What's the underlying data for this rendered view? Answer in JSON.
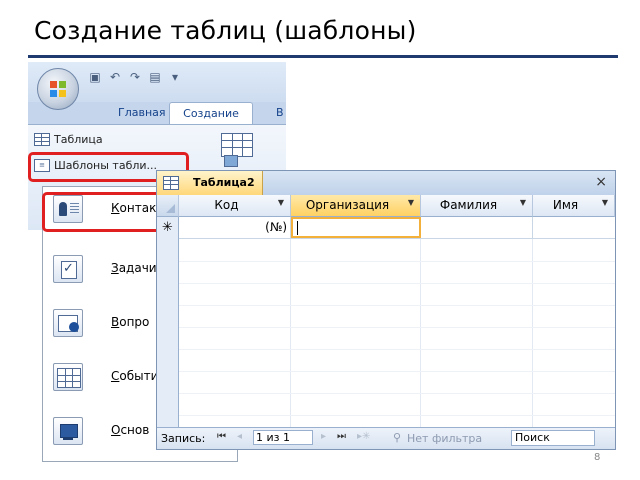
{
  "slide": {
    "title": "Создание таблиц (шаблоны)",
    "page_number": "8"
  },
  "ribbon": {
    "tabs": [
      "Главная",
      "Создание",
      "В"
    ],
    "table_label": "Таблица",
    "templates_label": "Шаблоны табли..."
  },
  "templates_menu": {
    "items": [
      {
        "accesskey": "К",
        "rest": "онтак",
        "icon": "contacts-icon"
      },
      {
        "accesskey": "З",
        "rest": "адачи",
        "icon": "tasks-icon"
      },
      {
        "accesskey": "В",
        "rest": "опро",
        "icon": "issues-icon"
      },
      {
        "accesskey": "С",
        "rest": "обыти",
        "icon": "events-icon"
      },
      {
        "accesskey": "О",
        "rest": "снов",
        "icon": "assets-icon"
      }
    ]
  },
  "datasheet": {
    "tab_title": "Таблица2",
    "close": "×",
    "columns": [
      "Код",
      "Организация",
      "Фамилия",
      "Имя"
    ],
    "new_row_marker": "✳",
    "new_row_code": "(№)",
    "nav": {
      "label": "Запись:",
      "first": "⏮",
      "prev": "◂",
      "position": "1 из 1",
      "next": "▸",
      "last": "⏭",
      "new": "▸✳",
      "filter": "Нет фильтра",
      "search": "Поиск"
    }
  },
  "colors": {
    "title_rule": "#1f3a6e",
    "highlight": "#e02020",
    "active_tab": "#ffd77a"
  }
}
